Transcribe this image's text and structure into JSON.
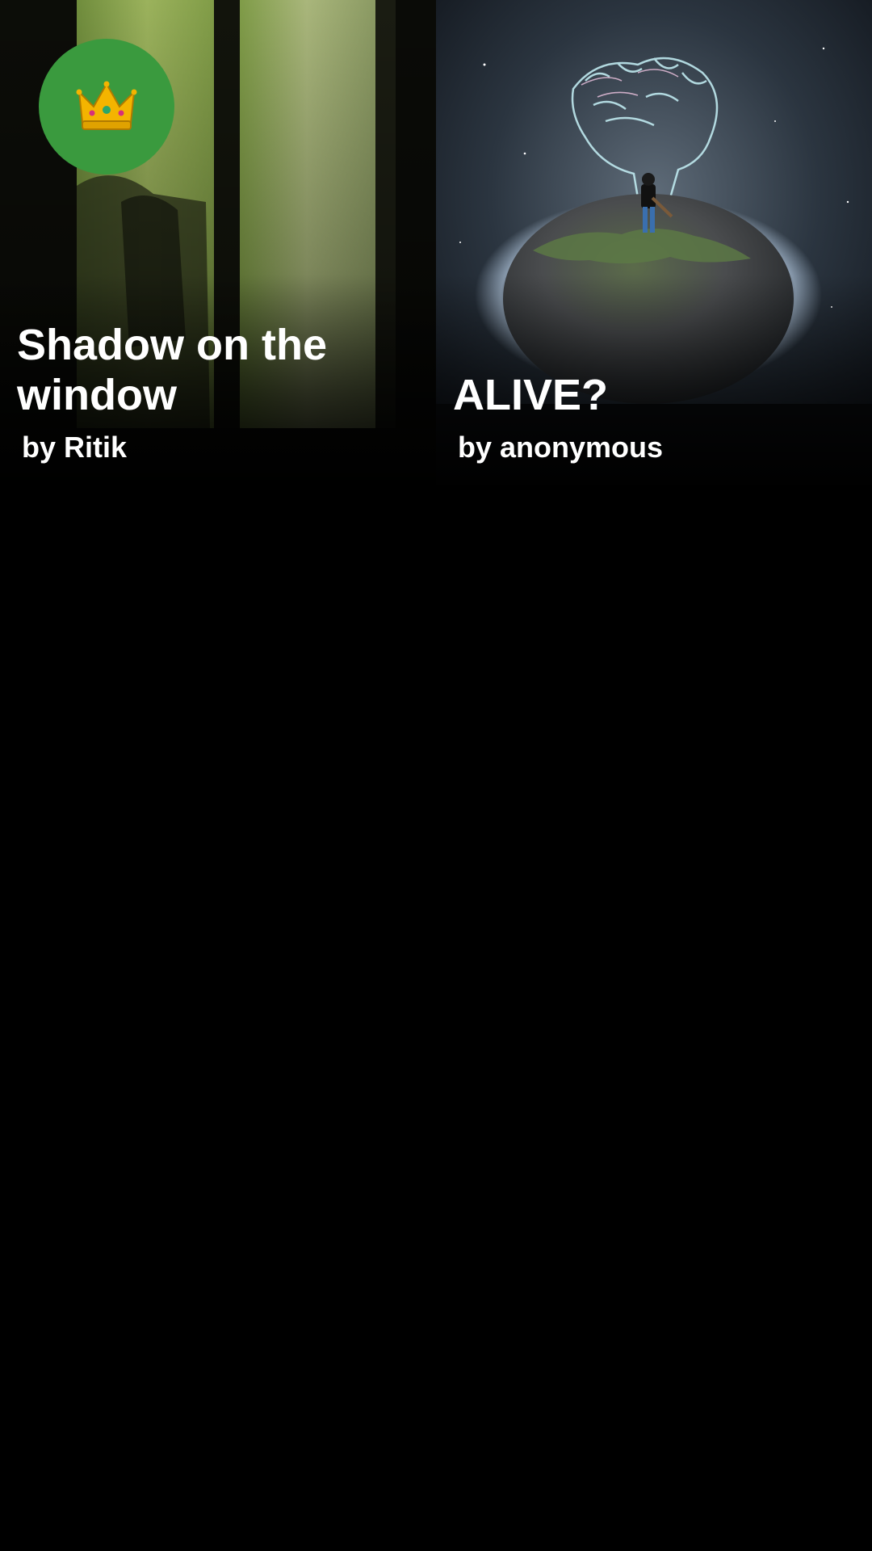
{
  "stories": [
    {
      "title": "Shadow on the window",
      "author": "by Ritik",
      "featured": true,
      "badge_icon": "crown-icon",
      "badge_color": "#3a9a3e"
    },
    {
      "title": "ALIVE?",
      "author": "by anonymous",
      "featured": false
    }
  ],
  "colors": {
    "background": "#000000",
    "text": "#ffffff"
  }
}
